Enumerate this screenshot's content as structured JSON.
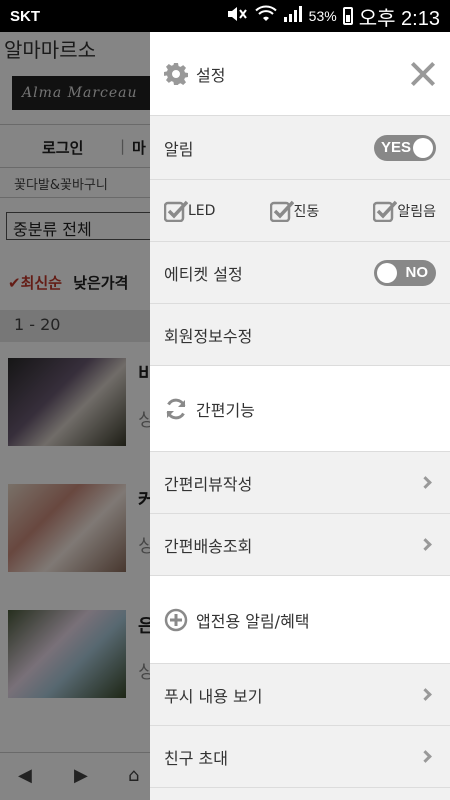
{
  "status_bar": {
    "carrier": "SKT",
    "battery_percent": "53%",
    "time": "오후 2:13"
  },
  "background_page": {
    "app_title": "알마마르소",
    "logo_text": "Alma Marceau",
    "login_label": "로그인",
    "login_next_fragment": "마",
    "category_text": "꽃다발&꽃바구니",
    "subcategory_select": "중분류 전체",
    "sort_active": "✔최신순",
    "sort_other": "낮은가격",
    "range_label": "1 - 20",
    "products": [
      {
        "title_fragment": "비",
        "sub_fragment": "싱"
      },
      {
        "title_fragment": "커",
        "sub_fragment": "싱"
      },
      {
        "title_fragment": "은",
        "sub_fragment": "싱"
      }
    ]
  },
  "drawer": {
    "header": {
      "icon": "gear-icon",
      "title": "설정",
      "close_icon": "close-icon"
    },
    "notification": {
      "label": "알림",
      "toggle_label": "YES",
      "on": true
    },
    "checks": [
      {
        "label": "LED",
        "checked": true
      },
      {
        "label": "진동",
        "checked": true
      },
      {
        "label": "알림음",
        "checked": true
      }
    ],
    "etiquette": {
      "label": "에티켓 설정",
      "toggle_label": "NO",
      "on": false
    },
    "member_info": {
      "label": "회원정보수정"
    },
    "quick_section": {
      "icon": "refresh-icon",
      "title": "간편기능"
    },
    "quick_items": [
      {
        "label": "간편리뷰작성"
      },
      {
        "label": "간편배송조회"
      }
    ],
    "app_section": {
      "icon": "plus-circle-icon",
      "title": "앱전용 알림/혜택"
    },
    "app_items": [
      {
        "label": "푸시 내용 보기"
      },
      {
        "label": "친구 초대"
      }
    ]
  },
  "colors": {
    "toggle_bg": "#888888",
    "row_gray": "#f1f1f1",
    "check_color": "#8a8a8a",
    "sort_accent": "#c0392b"
  }
}
